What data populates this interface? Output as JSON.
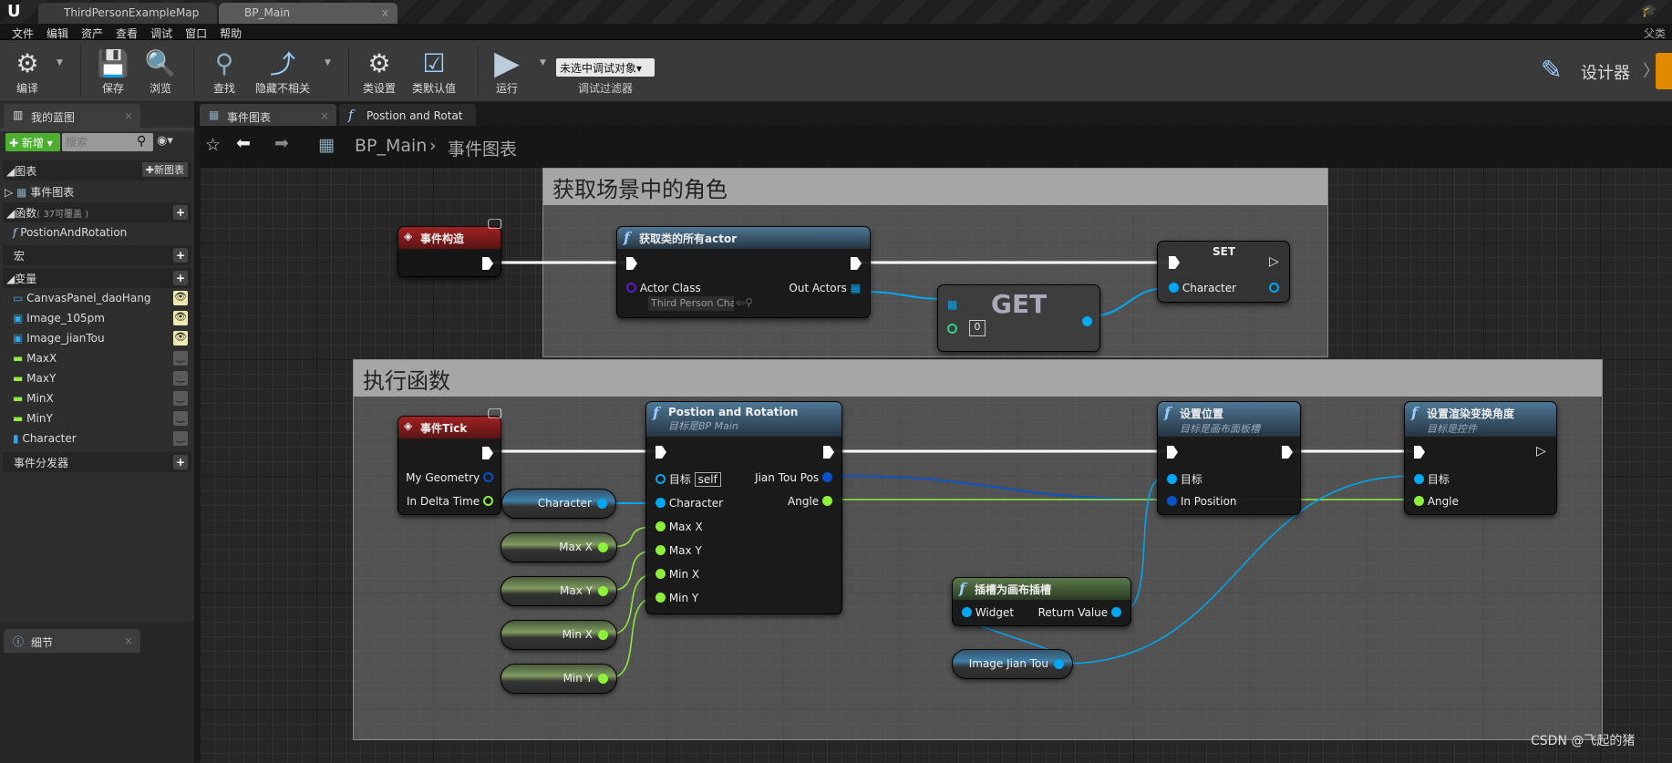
{
  "tabs": [
    {
      "label": "ThirdPersonExampleMap"
    },
    {
      "label": "BP_Main",
      "close": "x"
    }
  ],
  "menu": [
    "文件",
    "编辑",
    "资产",
    "查看",
    "调试",
    "窗口",
    "帮助"
  ],
  "toolbar": {
    "compile": "编译",
    "save": "保存",
    "browse": "浏览",
    "find": "查找",
    "hide_unrelated": "隐藏不相关",
    "class_settings": "类设置",
    "class_defaults": "类默认值",
    "run": "运行",
    "debug_select": "未选中调试对象▾",
    "debug_filter": "调试过滤器",
    "designer": "设计器",
    "top_right": "父类"
  },
  "left_panel": {
    "tab": "我的蓝图",
    "add_new": "新增",
    "search_placeholder": "搜索",
    "graphs": {
      "label": "图表",
      "new_graph": "新图表",
      "items": [
        "事件图表"
      ]
    },
    "functions": {
      "label": "函数",
      "override": "( 37可覆盖 )",
      "items": [
        "PostionAndRotation"
      ]
    },
    "macros": {
      "label": "宏"
    },
    "variables": {
      "label": "变量",
      "items": [
        {
          "name": "CanvasPanel_daoHang",
          "type": "widget",
          "visible": true
        },
        {
          "name": "Image_105pm",
          "type": "image",
          "visible": true
        },
        {
          "name": "Image_jianTou",
          "type": "image",
          "visible": true
        },
        {
          "name": "MaxX",
          "type": "float",
          "visible": false
        },
        {
          "name": "MaxY",
          "type": "float",
          "visible": false
        },
        {
          "name": "MinX",
          "type": "float",
          "visible": false
        },
        {
          "name": "MinY",
          "type": "float",
          "visible": false
        },
        {
          "name": "Character",
          "type": "object",
          "visible": false
        }
      ]
    },
    "dispatchers": {
      "label": "事件分发器"
    },
    "details_tab": "细节"
  },
  "editor_tabs": [
    {
      "label": "事件图表"
    },
    {
      "label": "Postion and Rotat"
    }
  ],
  "breadcrumb": {
    "root": "BP_Main",
    "sep": "›",
    "current": "事件图表"
  },
  "comments": [
    {
      "title": "获取场景中的角色"
    },
    {
      "title": "执行函数"
    }
  ],
  "nodes": {
    "construct": {
      "title": "事件构造"
    },
    "get_all": {
      "title": "获取类的所有actor",
      "actor_class": "Actor Class",
      "class_value": "Third Person Cha",
      "out": "Out Actors"
    },
    "get": {
      "title": "GET",
      "index": "0"
    },
    "set": {
      "title": "SET",
      "pin": "Character"
    },
    "tick": {
      "title": "事件Tick",
      "geometry": "My Geometry",
      "delta": "In Delta Time"
    },
    "var_character": "Character",
    "var_maxx": "Max X",
    "var_maxy": "Max Y",
    "var_minx": "Min X",
    "var_miny": "Min Y",
    "pos_rot": {
      "title": "Postion and Rotation",
      "subtitle": "目标是BP Main",
      "target": "目标",
      "self": "self",
      "character": "Character",
      "maxx": "Max X",
      "maxy": "Max Y",
      "minx": "Min X",
      "miny": "Min Y",
      "jtpos": "Jian Tou Pos",
      "angle": "Angle"
    },
    "set_pos": {
      "title": "设置位置",
      "subtitle": "目标是画布面板槽",
      "target": "目标",
      "in_pos": "In Position"
    },
    "set_angle": {
      "title": "设置渲染变换角度",
      "subtitle": "目标是控件",
      "target": "目标",
      "angle": "Angle"
    },
    "slot": {
      "title": "插槽为画布插槽",
      "widget": "Widget",
      "ret": "Return Value"
    },
    "var_image": "Image Jian Tou"
  },
  "watermark": "CSDN @飞起的猪",
  "colors": {
    "object_pin": "#00a8f4",
    "float_pin": "#8ff03c",
    "vector_pin": "#0a52c8",
    "exec": "#ffffff",
    "event_header": "#a02222",
    "function_header": "#4e7896",
    "accent_green": "#4caf32",
    "designer_orange": "#e08a00"
  }
}
